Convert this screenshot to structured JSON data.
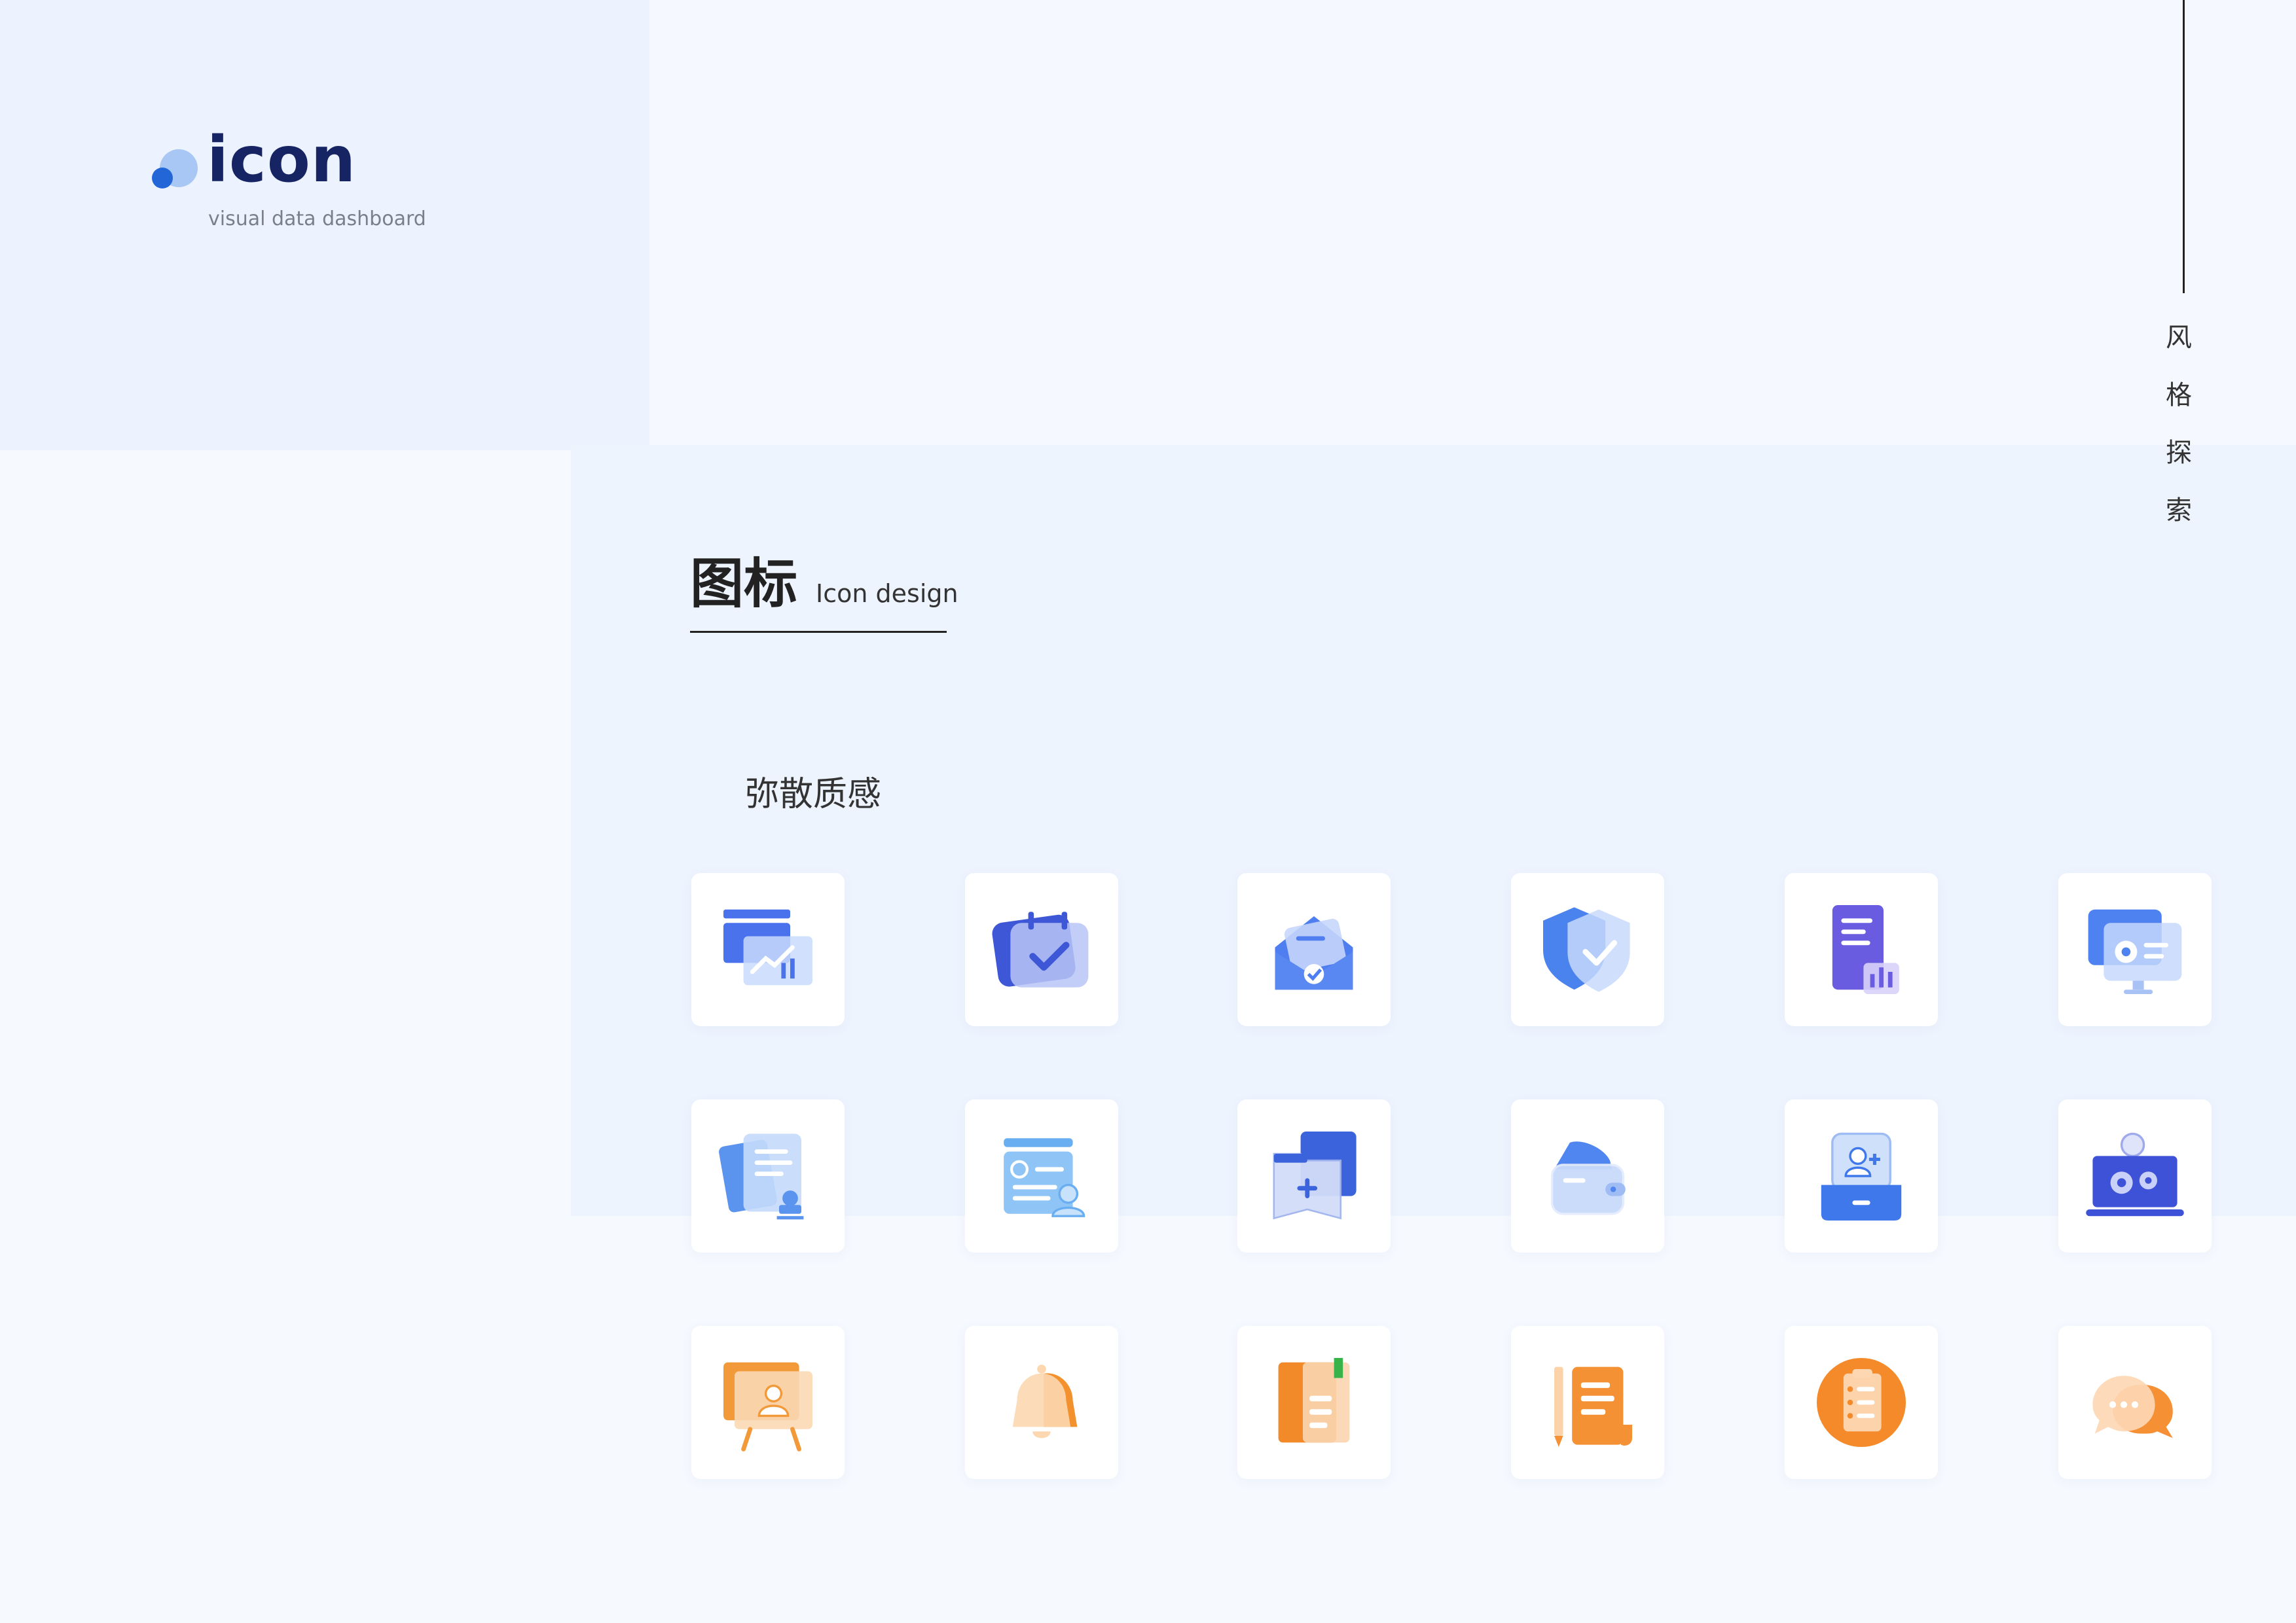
{
  "brand": {
    "title": "icon",
    "subtitle": "visual data dashboard"
  },
  "side_label": [
    "风",
    "格",
    "探",
    "索"
  ],
  "heading": {
    "cn": "图标",
    "en": "Icon design"
  },
  "section_label": "弥散质感",
  "icons": [
    {
      "name": "chart-dashboard-icon",
      "color": "#4a72ec"
    },
    {
      "name": "calendar-check-icon",
      "color": "#3e57d6"
    },
    {
      "name": "mail-open-icon",
      "color": "#4e7ef0"
    },
    {
      "name": "shield-check-icon",
      "color": "#4a82ee"
    },
    {
      "name": "document-chart-icon",
      "color": "#6a5ce0"
    },
    {
      "name": "monitor-settings-icon",
      "color": "#4d82f0"
    },
    {
      "name": "documents-stamp-icon",
      "color": "#5b94ee"
    },
    {
      "name": "profile-card-icon",
      "color": "#6aaef2"
    },
    {
      "name": "folder-add-icon",
      "color": "#3a63dc"
    },
    {
      "name": "wallet-icon",
      "color": "#4f86ef"
    },
    {
      "name": "user-add-tray-icon",
      "color": "#3f78ea"
    },
    {
      "name": "laptop-gears-icon",
      "color": "#3e52d8"
    },
    {
      "name": "presentation-board-icon",
      "color": "#f29a3a"
    },
    {
      "name": "notification-bell-icon",
      "color": "#f4912f"
    },
    {
      "name": "book-notes-icon",
      "color": "#f28a2a"
    },
    {
      "name": "scroll-pencil-icon",
      "color": "#f39134"
    },
    {
      "name": "clipboard-checklist-icon",
      "color": "#f58a2a"
    },
    {
      "name": "chat-bubbles-icon",
      "color": "#f59035"
    }
  ]
}
